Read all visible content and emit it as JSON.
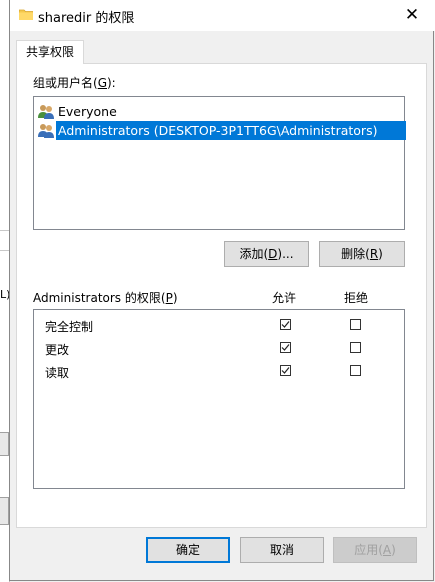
{
  "window": {
    "title": "sharedir 的权限",
    "close_glyph": "✕"
  },
  "tab": {
    "label": "共享权限"
  },
  "group_section": {
    "label_prefix": "组或用户名(",
    "label_hotkey": "G",
    "label_suffix": "):",
    "users": [
      {
        "name": "Everyone",
        "selected": false,
        "icon": "users-group-icon"
      },
      {
        "name": "Administrators (DESKTOP-3P1TT6G\\Administrators)",
        "selected": true,
        "icon": "users-group-icon"
      }
    ],
    "add_button": {
      "prefix": "添加(",
      "hotkey": "D",
      "suffix": ")..."
    },
    "remove_button": {
      "prefix": "删除(",
      "hotkey": "R",
      "suffix": ")"
    }
  },
  "permissions_section": {
    "label_prefix": "Administrators 的权限(",
    "label_hotkey": "P",
    "label_suffix": ")",
    "allow_header": "允许",
    "deny_header": "拒绝",
    "rows": [
      {
        "name": "完全控制",
        "allow": true,
        "deny": false
      },
      {
        "name": "更改",
        "allow": true,
        "deny": false
      },
      {
        "name": "读取",
        "allow": true,
        "deny": false
      }
    ]
  },
  "footer": {
    "ok_label": "确定",
    "cancel_label": "取消",
    "apply_prefix": "应用(",
    "apply_hotkey": "A",
    "apply_suffix": ")"
  },
  "background_window": {
    "fragment_text": "L)"
  },
  "colors": {
    "accent": "#0078d7",
    "selection_bg": "#0078d7",
    "dialog_bg": "#f0f0f0"
  }
}
